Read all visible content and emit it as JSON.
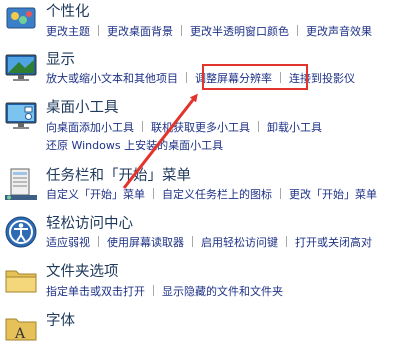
{
  "sections": [
    {
      "title": "个性化",
      "icon": "personalization-icon",
      "links": [
        "更改主题",
        "更改桌面背景",
        "更改半透明窗口颜色",
        "更改声音效果"
      ]
    },
    {
      "title": "显示",
      "icon": "display-icon",
      "links": [
        "放大或缩小文本和其他项目",
        "调整屏幕分辨率",
        "连接到投影仪"
      ]
    },
    {
      "title": "桌面小工具",
      "icon": "desktop-gadgets-icon",
      "links": [
        "向桌面添加小工具",
        "联机获取更多小工具",
        "卸载小工具"
      ],
      "links2": [
        "还原 Windows 上安装的桌面小工具"
      ]
    },
    {
      "title": "任务栏和「开始」菜单",
      "icon": "taskbar-start-menu-icon",
      "links": [
        "自定义「开始」菜单",
        "自定义任务栏上的图标",
        "更改「开始」菜单"
      ]
    },
    {
      "title": "轻松访问中心",
      "icon": "ease-of-access-icon",
      "links": [
        "适应弱视",
        "使用屏幕读取器",
        "启用轻松访问键",
        "打开或关闭高对"
      ]
    },
    {
      "title": "文件夹选项",
      "icon": "folder-options-icon",
      "links": [
        "指定单击或双击打开",
        "显示隐藏的文件和文件夹"
      ]
    },
    {
      "title": "字体",
      "icon": "fonts-icon",
      "links": []
    }
  ],
  "annotation": {
    "highlight_color": "#e2332c"
  }
}
